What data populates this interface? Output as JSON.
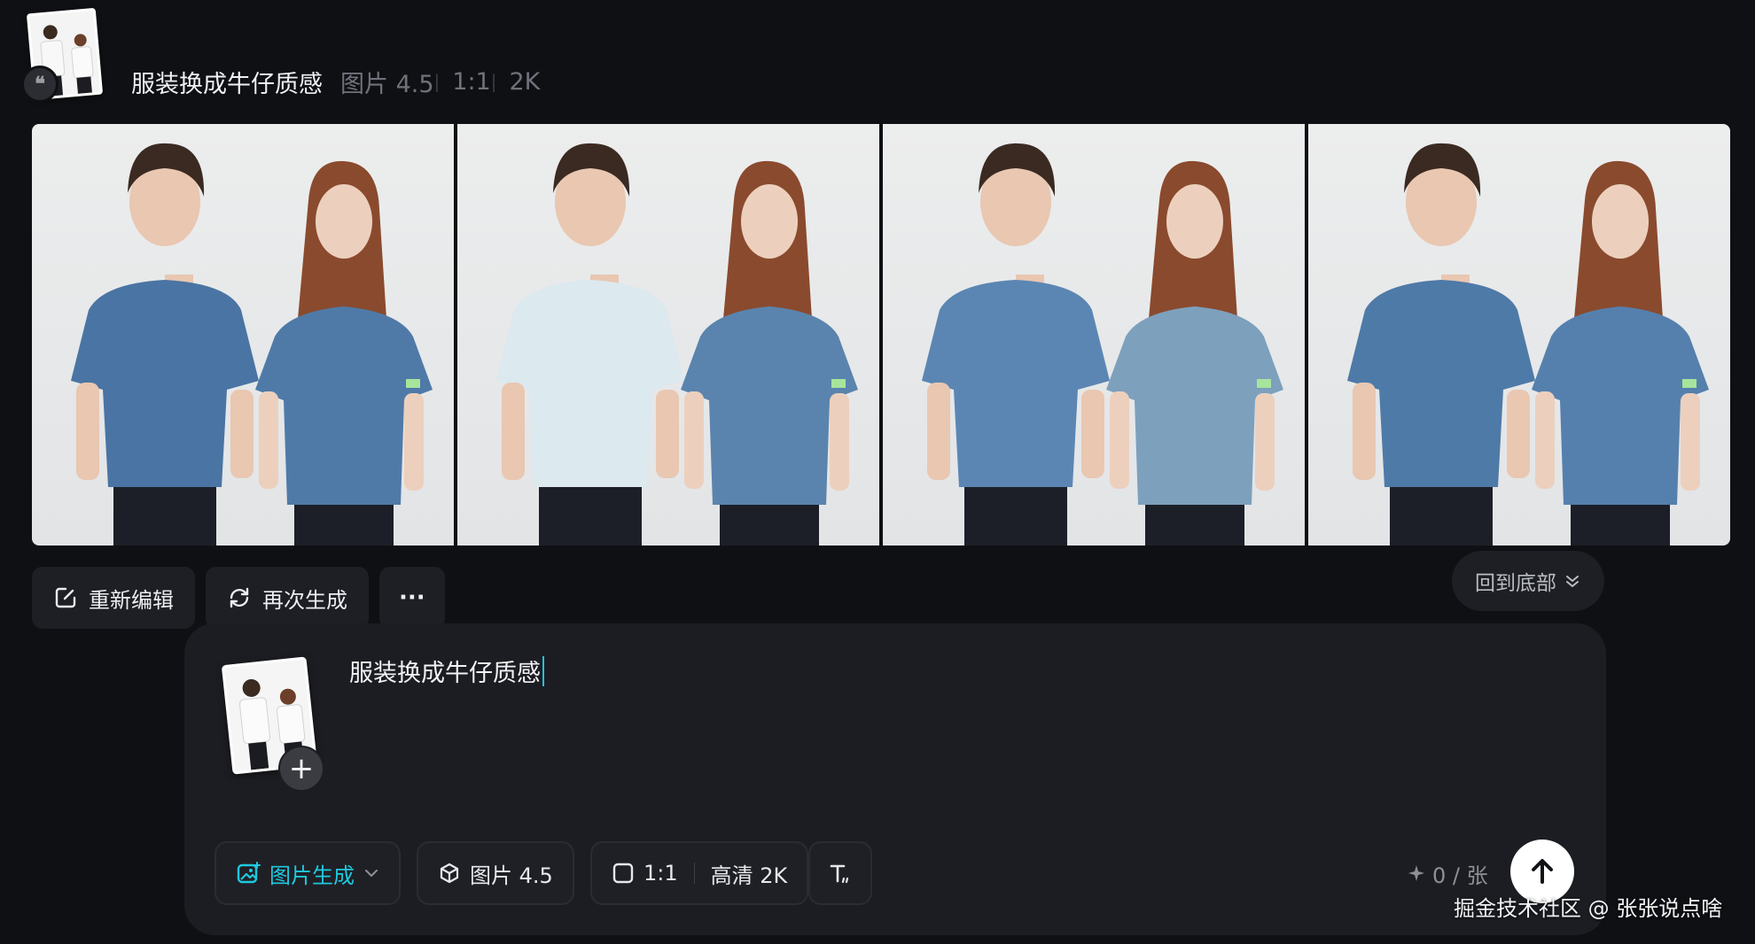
{
  "history": {
    "prompt": "服装换成牛仔质感",
    "model": "图片 4.5",
    "ratio": "1:1",
    "resolution": "2K"
  },
  "results": [
    {
      "label": "result-1",
      "male_shirt": "#4a74a3",
      "female_shirt": "#4f7aa8"
    },
    {
      "label": "result-2",
      "male_shirt": "#dce9ef",
      "female_shirt": "#5a84ad"
    },
    {
      "label": "result-3",
      "male_shirt": "#5b86b3",
      "female_shirt": "#7da0bd"
    },
    {
      "label": "result-4",
      "male_shirt": "#4e7aa8",
      "female_shirt": "#5580ad"
    }
  ],
  "actions": {
    "reedit": "重新编辑",
    "regenerate": "再次生成",
    "more": "···",
    "back_to_bottom": "回到底部"
  },
  "composer": {
    "input_value": "服装换成牛仔质感",
    "mode": "图片生成",
    "model": "图片 4.5",
    "ratio": "1:1",
    "quality": "高清 2K",
    "credits": "0 / 张"
  },
  "watermark": "掘金技术社区 @ 张张说点啥",
  "colors": {
    "background": "#0f1014",
    "accent": "#1fc8df",
    "panel": "#1c1d22"
  }
}
